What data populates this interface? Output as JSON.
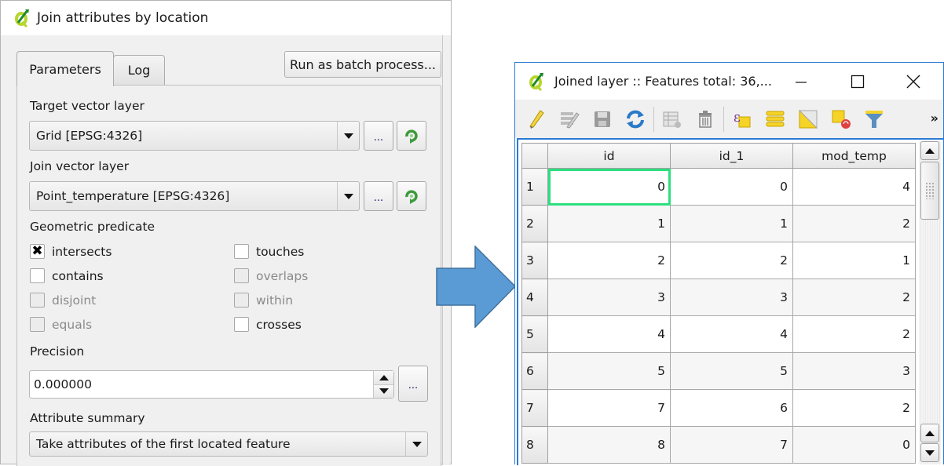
{
  "dialog": {
    "title": "Join attributes by location",
    "tabs": [
      {
        "label": "Parameters",
        "active": true
      },
      {
        "label": "Log",
        "active": false
      }
    ],
    "batch_button": "Run as batch process...",
    "target_layer": {
      "label": "Target vector layer",
      "value": "Grid [EPSG:4326]",
      "more_button": "...",
      "iterate_icon": "green-refresh-icon"
    },
    "join_layer": {
      "label": "Join vector layer",
      "value": "Point_temperature [EPSG:4326]",
      "more_button": "...",
      "iterate_icon": "green-refresh-icon"
    },
    "geometric_predicate": {
      "label": "Geometric predicate",
      "options": [
        {
          "label": "intersects",
          "checked": true,
          "enabled": true
        },
        {
          "label": "touches",
          "checked": false,
          "enabled": true
        },
        {
          "label": "contains",
          "checked": false,
          "enabled": true
        },
        {
          "label": "overlaps",
          "checked": false,
          "enabled": false
        },
        {
          "label": "disjoint",
          "checked": false,
          "enabled": false
        },
        {
          "label": "within",
          "checked": false,
          "enabled": false
        },
        {
          "label": "equals",
          "checked": false,
          "enabled": false
        },
        {
          "label": "crosses",
          "checked": false,
          "enabled": true
        }
      ]
    },
    "precision": {
      "label": "Precision",
      "value": "0.000000",
      "more_button": "..."
    },
    "attribute_summary": {
      "label": "Attribute summary",
      "value": "Take attributes of the first located feature"
    }
  },
  "arrow": {
    "color": "#5b9bd5",
    "icon": "right-arrow"
  },
  "attribute_table": {
    "title": "Joined layer :: Features total: 36,...",
    "window_controls": {
      "minimize": "—",
      "maximize": "☐",
      "close": "✕"
    },
    "toolbar": [
      "toggle-editing-icon",
      "multi-edit-icon",
      "save-edits-icon",
      "reload-icon",
      "add-feature-icon",
      "delete-feature-icon",
      "select-by-expression-icon",
      "select-all-icon",
      "invert-selection-icon",
      "deselect-all-icon",
      "filter-icon"
    ],
    "toolbar_overflow": "»",
    "columns": [
      "id",
      "id_1",
      "mod_temp"
    ],
    "rows": [
      {
        "n": "1",
        "cells": [
          "0",
          "0",
          "4"
        ]
      },
      {
        "n": "2",
        "cells": [
          "1",
          "1",
          "2"
        ]
      },
      {
        "n": "3",
        "cells": [
          "2",
          "2",
          "1"
        ]
      },
      {
        "n": "4",
        "cells": [
          "3",
          "3",
          "2"
        ]
      },
      {
        "n": "5",
        "cells": [
          "4",
          "4",
          "2"
        ]
      },
      {
        "n": "6",
        "cells": [
          "5",
          "5",
          "3"
        ]
      },
      {
        "n": "7",
        "cells": [
          "7",
          "6",
          "2"
        ]
      },
      {
        "n": "8",
        "cells": [
          "8",
          "7",
          "0"
        ]
      }
    ],
    "selected_cell": {
      "row": 1,
      "column": "id"
    },
    "selection_color": "#2ddf7e"
  }
}
